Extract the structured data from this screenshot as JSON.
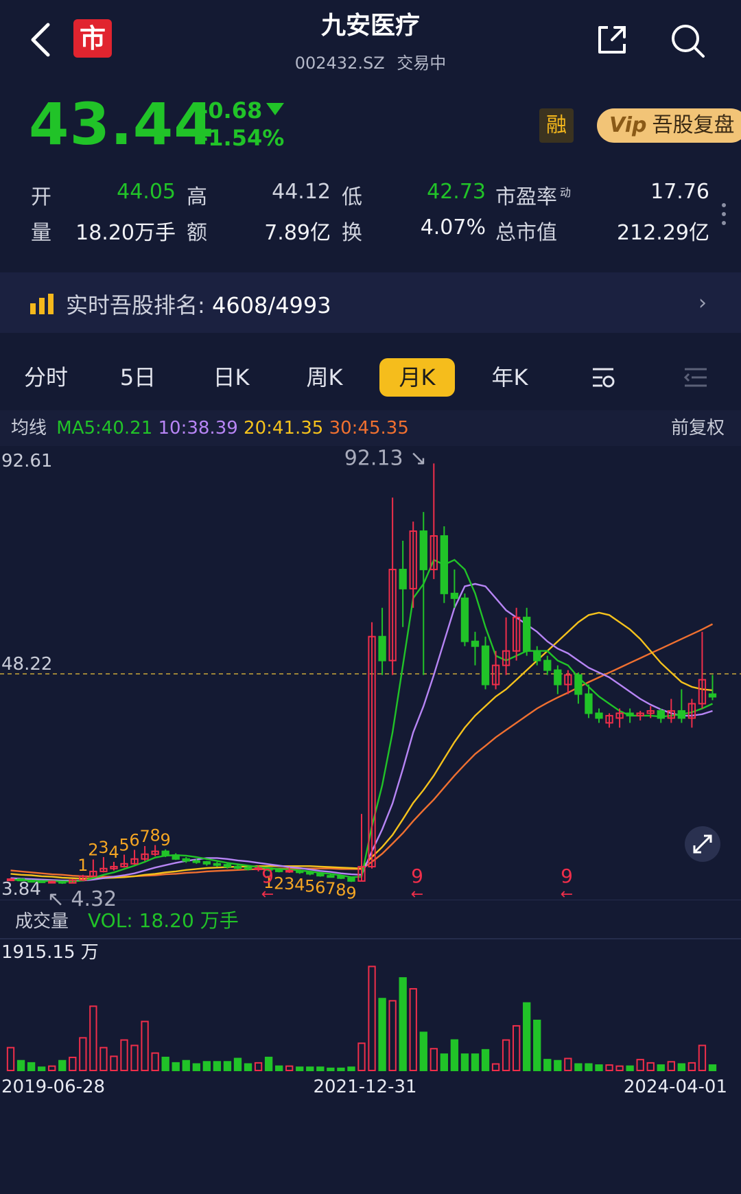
{
  "header": {
    "title": "九安医疗",
    "code": "002432.SZ",
    "status": "交易中",
    "logo_text": "市"
  },
  "quote": {
    "price": "43.44",
    "change": "-0.68",
    "change_pct": "-1.54%",
    "rong": "融",
    "vip_mark": "Vip",
    "vip_label": "吾股复盘",
    "open_label": "开",
    "open": "44.05",
    "high_label": "高",
    "high": "44.12",
    "low_label": "低",
    "low": "42.73",
    "pe_label": "市盈率",
    "pe_sup": "动",
    "pe": "17.76",
    "vol_label": "量",
    "vol": "18.20万手",
    "amount_label": "额",
    "amount": "7.89亿",
    "turnover_label": "换",
    "turnover": "4.07%",
    "mktcap_label": "总市值",
    "mktcap": "212.29亿"
  },
  "rank": {
    "label": "实时吾股排名:",
    "value": "4608/4993"
  },
  "tabs": [
    "分时",
    "5日",
    "日K",
    "周K",
    "月K",
    "年K"
  ],
  "active_tab": "月K",
  "ma": {
    "label": "均线",
    "ma5": "MA5:40.21",
    "ma10": "10:38.39",
    "ma20": "20:41.35",
    "ma30": "30:45.35",
    "adjust": "前复权"
  },
  "colors": {
    "up": "#ef2e4a",
    "down": "#21c328",
    "ma5": "#21c328",
    "ma10": "#b785f5",
    "ma20": "#f5c21c",
    "ma30": "#f07030",
    "background": "#141a33"
  },
  "chart_data": {
    "type": "candlestick",
    "y_axis_top": "92.61",
    "y_axis_mid": "48.22",
    "y_axis_bottom": "3.84",
    "ylim": [
      3.84,
      92.61
    ],
    "ref_line": 48.22,
    "max_label": "92.13",
    "min_label": "4.32",
    "signal_labels": [
      "9",
      "9",
      "9"
    ],
    "td_top_seq": [
      "1",
      "2",
      "3",
      "4",
      "5",
      "6",
      "7",
      "8",
      "9"
    ],
    "td_bottom_seq": [
      "1",
      "2",
      "3",
      "4",
      "5",
      "6",
      "7",
      "8",
      "9"
    ],
    "vol_title": "成交量",
    "vol_label": "VOL: 18.20 万手",
    "vol_top": "1915.15 万",
    "dates": [
      "2019-06-28",
      "2021-12-31",
      "2024-04-01"
    ],
    "candles": [
      {
        "o": 5.2,
        "c": 5.4,
        "h": 5.6,
        "l": 5.0
      },
      {
        "o": 5.4,
        "c": 5.1,
        "h": 5.6,
        "l": 4.9
      },
      {
        "o": 5.1,
        "c": 5.0,
        "h": 5.3,
        "l": 4.8
      },
      {
        "o": 5.0,
        "c": 4.8,
        "h": 5.2,
        "l": 4.6
      },
      {
        "o": 4.8,
        "c": 4.9,
        "h": 5.1,
        "l": 4.6
      },
      {
        "o": 4.9,
        "c": 4.6,
        "h": 5.0,
        "l": 4.4
      },
      {
        "o": 4.6,
        "c": 5.2,
        "h": 5.4,
        "l": 4.5
      },
      {
        "o": 5.2,
        "c": 6.0,
        "h": 6.3,
        "l": 5.0
      },
      {
        "o": 6.0,
        "c": 7.0,
        "h": 9.5,
        "l": 5.8
      },
      {
        "o": 7.0,
        "c": 7.6,
        "h": 10.0,
        "l": 6.8
      },
      {
        "o": 7.6,
        "c": 8.0,
        "h": 9.0,
        "l": 7.2
      },
      {
        "o": 8.0,
        "c": 8.6,
        "h": 10.5,
        "l": 7.8
      },
      {
        "o": 8.6,
        "c": 9.6,
        "h": 11.5,
        "l": 8.4
      },
      {
        "o": 9.6,
        "c": 10.6,
        "h": 12.3,
        "l": 9.2
      },
      {
        "o": 10.6,
        "c": 11.2,
        "h": 12.5,
        "l": 10.2
      },
      {
        "o": 11.2,
        "c": 10.4,
        "h": 11.6,
        "l": 10.0
      },
      {
        "o": 10.4,
        "c": 9.6,
        "h": 10.8,
        "l": 9.4
      },
      {
        "o": 9.6,
        "c": 9.2,
        "h": 10.0,
        "l": 8.8
      },
      {
        "o": 9.2,
        "c": 9.0,
        "h": 9.6,
        "l": 8.6
      },
      {
        "o": 9.0,
        "c": 8.6,
        "h": 9.2,
        "l": 8.2
      },
      {
        "o": 8.6,
        "c": 8.4,
        "h": 9.0,
        "l": 8.0
      },
      {
        "o": 8.4,
        "c": 8.0,
        "h": 8.8,
        "l": 7.6
      },
      {
        "o": 8.0,
        "c": 7.8,
        "h": 8.4,
        "l": 7.4
      },
      {
        "o": 7.8,
        "c": 7.5,
        "h": 8.0,
        "l": 7.2
      },
      {
        "o": 7.5,
        "c": 7.7,
        "h": 8.2,
        "l": 7.0
      },
      {
        "o": 7.7,
        "c": 7.3,
        "h": 8.0,
        "l": 7.0
      },
      {
        "o": 7.3,
        "c": 7.0,
        "h": 7.6,
        "l": 6.8
      },
      {
        "o": 7.0,
        "c": 7.2,
        "h": 7.8,
        "l": 6.7
      },
      {
        "o": 7.2,
        "c": 6.8,
        "h": 7.4,
        "l": 6.5
      },
      {
        "o": 6.8,
        "c": 6.5,
        "h": 7.0,
        "l": 6.2
      },
      {
        "o": 6.5,
        "c": 6.1,
        "h": 6.7,
        "l": 5.9
      },
      {
        "o": 6.1,
        "c": 6.0,
        "h": 6.4,
        "l": 5.7
      },
      {
        "o": 6.0,
        "c": 5.6,
        "h": 6.2,
        "l": 5.4
      },
      {
        "o": 5.6,
        "c": 5.0,
        "h": 5.8,
        "l": 4.8
      },
      {
        "o": 5.0,
        "c": 8.0,
        "h": 19.0,
        "l": 4.9
      },
      {
        "o": 8.0,
        "c": 56.0,
        "h": 59.0,
        "l": 7.6
      },
      {
        "o": 56.0,
        "c": 51.0,
        "h": 62.0,
        "l": 48.0
      },
      {
        "o": 51.0,
        "c": 70.0,
        "h": 85.0,
        "l": 48.0
      },
      {
        "o": 70.0,
        "c": 66.0,
        "h": 76.0,
        "l": 58.0
      },
      {
        "o": 66.0,
        "c": 78.0,
        "h": 80.0,
        "l": 62.0
      },
      {
        "o": 78.0,
        "c": 70.0,
        "h": 82.0,
        "l": 48.0
      },
      {
        "o": 70.0,
        "c": 77.0,
        "h": 92.13,
        "l": 68.0
      },
      {
        "o": 77.0,
        "c": 65.0,
        "h": 79.0,
        "l": 63.0
      },
      {
        "o": 65.0,
        "c": 64.0,
        "h": 70.0,
        "l": 62.0
      },
      {
        "o": 64.0,
        "c": 55.0,
        "h": 65.0,
        "l": 54.0
      },
      {
        "o": 55.0,
        "c": 54.0,
        "h": 57.0,
        "l": 50.0
      },
      {
        "o": 54.0,
        "c": 46.0,
        "h": 56.0,
        "l": 45.0
      },
      {
        "o": 46.0,
        "c": 50.0,
        "h": 53.0,
        "l": 45.0
      },
      {
        "o": 50.0,
        "c": 53.0,
        "h": 60.0,
        "l": 48.0
      },
      {
        "o": 53.0,
        "c": 60.0,
        "h": 62.0,
        "l": 51.0
      },
      {
        "o": 60.0,
        "c": 53.0,
        "h": 62.0,
        "l": 52.0
      },
      {
        "o": 53.0,
        "c": 51.0,
        "h": 54.0,
        "l": 50.0
      },
      {
        "o": 51.0,
        "c": 49.0,
        "h": 52.0,
        "l": 48.0
      },
      {
        "o": 49.0,
        "c": 46.0,
        "h": 50.0,
        "l": 44.0
      },
      {
        "o": 46.0,
        "c": 48.0,
        "h": 49.0,
        "l": 44.0
      },
      {
        "o": 48.0,
        "c": 44.0,
        "h": 48.5,
        "l": 42.0
      },
      {
        "o": 44.0,
        "c": 40.0,
        "h": 46.0,
        "l": 39.0
      },
      {
        "o": 40.0,
        "c": 39.0,
        "h": 41.0,
        "l": 38.0
      },
      {
        "o": 38.0,
        "c": 39.5,
        "h": 40.0,
        "l": 37.0
      },
      {
        "o": 39.0,
        "c": 40.0,
        "h": 41.0,
        "l": 37.0
      },
      {
        "o": 40.0,
        "c": 39.5,
        "h": 41.0,
        "l": 38.0
      },
      {
        "o": 39.5,
        "c": 40.0,
        "h": 40.5,
        "l": 38.5
      },
      {
        "o": 40.0,
        "c": 40.5,
        "h": 41.5,
        "l": 39.0
      },
      {
        "o": 40.5,
        "c": 39.0,
        "h": 41.0,
        "l": 38.0
      },
      {
        "o": 39.0,
        "c": 40.5,
        "h": 43.0,
        "l": 38.0
      },
      {
        "o": 40.5,
        "c": 39.0,
        "h": 45.0,
        "l": 38.0
      },
      {
        "o": 39.0,
        "c": 42.0,
        "h": 43.0,
        "l": 37.0
      },
      {
        "o": 42.0,
        "c": 47.0,
        "h": 57.0,
        "l": 41.0
      },
      {
        "o": 44.0,
        "c": 43.44,
        "h": 48.0,
        "l": 42.73
      }
    ],
    "ma5_series": [
      5.3,
      5.2,
      5.1,
      5.0,
      5.0,
      4.9,
      4.9,
      5.1,
      5.6,
      6.3,
      6.8,
      7.5,
      8.2,
      9.0,
      9.9,
      10.3,
      10.4,
      10.3,
      10.0,
      9.6,
      9.2,
      8.8,
      8.5,
      8.2,
      7.9,
      7.7,
      7.5,
      7.4,
      7.2,
      7.0,
      6.7,
      6.5,
      6.2,
      5.8,
      5.9,
      16.4,
      25.0,
      36.0,
      50.0,
      64.0,
      67.0,
      72.0,
      71.0,
      72.0,
      70.0,
      65.0,
      58.0,
      52.0,
      51.0,
      52.0,
      53.0,
      53.0,
      53.0,
      51.0,
      50.0,
      47.5,
      45.5,
      43.5,
      42.0,
      40.5,
      39.5,
      39.5,
      39.5,
      39.3,
      39.5,
      39.8,
      40.2,
      41.0,
      42.0
    ],
    "ma10_series": [
      5.6,
      5.5,
      5.4,
      5.3,
      5.2,
      5.1,
      5.1,
      5.1,
      5.3,
      5.6,
      5.9,
      6.2,
      6.6,
      7.2,
      7.8,
      8.3,
      8.8,
      9.2,
      9.5,
      9.8,
      9.8,
      9.6,
      9.3,
      9.1,
      8.8,
      8.5,
      8.2,
      7.9,
      7.7,
      7.4,
      7.1,
      6.9,
      6.6,
      6.4,
      6.3,
      11.2,
      15.8,
      21.2,
      28.4,
      36.0,
      41.5,
      48.0,
      55.0,
      62.0,
      66.5,
      67.0,
      66.5,
      64.0,
      61.5,
      60.0,
      58.5,
      57.0,
      55.0,
      53.5,
      52.5,
      51.0,
      49.5,
      48.5,
      47.5,
      46.0,
      44.5,
      43.0,
      41.8,
      40.8,
      40.0,
      39.5,
      39.5,
      39.8,
      40.5
    ],
    "ma20_series": [
      6.5,
      6.3,
      6.2,
      6.0,
      5.9,
      5.7,
      5.6,
      5.5,
      5.5,
      5.6,
      5.7,
      5.8,
      6.0,
      6.3,
      6.5,
      6.8,
      7.0,
      7.3,
      7.5,
      7.7,
      7.8,
      7.9,
      8.0,
      8.0,
      8.1,
      8.1,
      8.1,
      8.1,
      8.1,
      8.1,
      8.0,
      7.9,
      7.8,
      7.7,
      7.6,
      10.0,
      12.1,
      14.6,
      17.9,
      21.3,
      24.0,
      27.0,
      30.5,
      34.0,
      37.0,
      39.5,
      41.5,
      43.5,
      45.0,
      47.0,
      49.0,
      51.0,
      53.0,
      55.0,
      57.0,
      59.0,
      60.5,
      61.0,
      60.5,
      59.0,
      57.5,
      55.5,
      53.0,
      50.5,
      48.5,
      46.5,
      45.5,
      45.0,
      44.8
    ],
    "ma30_series": [
      7.2,
      7.0,
      6.8,
      6.6,
      6.4,
      6.3,
      6.1,
      6.0,
      5.9,
      5.9,
      5.9,
      5.9,
      6.0,
      6.1,
      6.2,
      6.4,
      6.5,
      6.7,
      6.8,
      7.0,
      7.1,
      7.2,
      7.3,
      7.4,
      7.5,
      7.5,
      7.6,
      7.6,
      7.6,
      7.6,
      7.6,
      7.6,
      7.5,
      7.5,
      7.5,
      9.0,
      10.7,
      12.8,
      15.0,
      17.5,
      19.8,
      22.0,
      24.5,
      27.0,
      29.3,
      31.5,
      33.2,
      35.0,
      36.5,
      38.0,
      39.5,
      41.0,
      42.2,
      43.3,
      44.3,
      45.4,
      46.5,
      47.5,
      48.5,
      49.5,
      50.5,
      51.5,
      52.5,
      53.5,
      54.5,
      55.5,
      56.5,
      57.5,
      58.6
    ],
    "volumes": [
      420,
      180,
      140,
      60,
      80,
      180,
      240,
      600,
      1180,
      420,
      260,
      560,
      460,
      900,
      320,
      240,
      140,
      180,
      120,
      160,
      160,
      160,
      220,
      120,
      140,
      240,
      80,
      80,
      60,
      60,
      60,
      40,
      40,
      60,
      500,
      1910,
      1320,
      1280,
      1700,
      1500,
      700,
      400,
      300,
      560,
      300,
      300,
      380,
      120,
      560,
      820,
      1240,
      920,
      200,
      180,
      220,
      120,
      120,
      100,
      100,
      80,
      80,
      200,
      140,
      100,
      160,
      120,
      140,
      460,
      100
    ],
    "vol_max": 1915.15
  }
}
